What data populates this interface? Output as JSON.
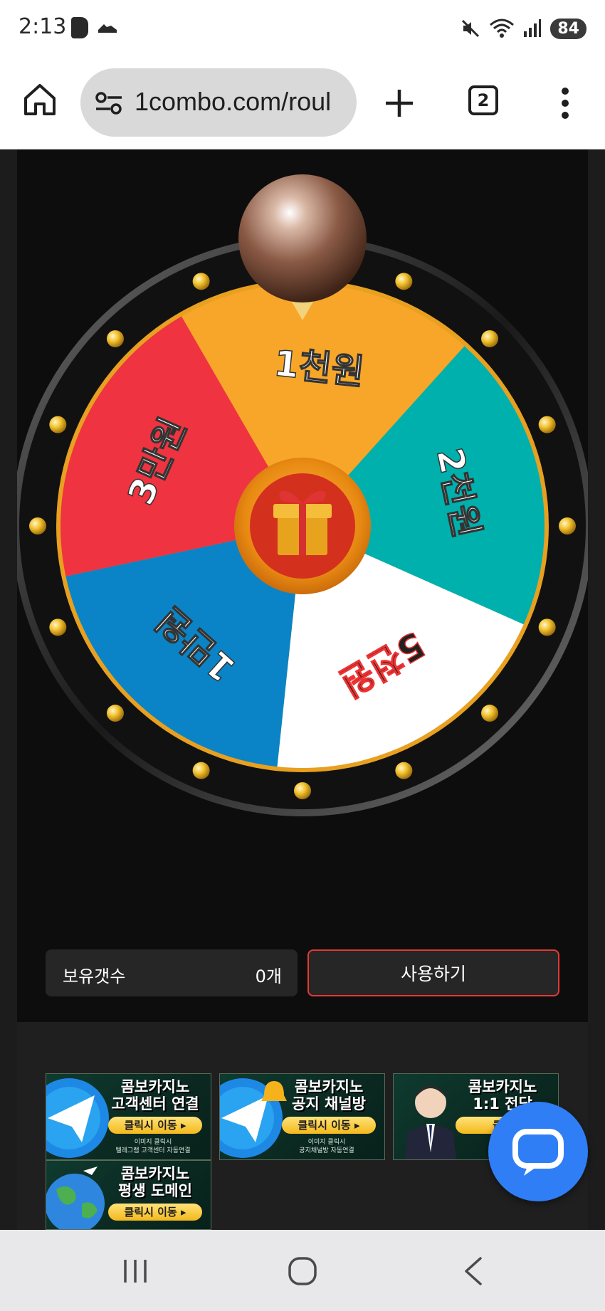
{
  "status_bar": {
    "time": "2:13",
    "battery": "84",
    "icons": [
      "b-app-icon",
      "shoe-app-icon",
      "mute-icon",
      "wifi-icon",
      "signal-icon",
      "battery-icon"
    ]
  },
  "browser": {
    "url": "1combo.com/roul",
    "tab_count": "2",
    "icons": [
      "home-icon",
      "site-settings-icon",
      "new-tab-plus-icon",
      "tabs-icon",
      "more-menu-icon"
    ]
  },
  "wheel": {
    "segments": [
      {
        "label": "1천원",
        "color": "#f7a629",
        "text_color": "#ffffff"
      },
      {
        "label": "2천원",
        "color": "#00b0ad",
        "text_color": "#ffffff"
      },
      {
        "label": "5천원",
        "color": "#ffffff",
        "text_color": "#222222"
      },
      {
        "label": "1만원",
        "color": "#0a84c6",
        "text_color": "#ffffff"
      },
      {
        "label": "3만원",
        "color": "#ef3340",
        "text_color": "#ffffff"
      }
    ],
    "center_icon": "gift-box-icon",
    "pointer_icon": "bronze-ball-pointer-icon",
    "rim_color": "#1a1a1a",
    "bulb_color": "#f0b429"
  },
  "controls": {
    "count_label": "보유갯수",
    "count_value": "0개",
    "use_button": "사용하기"
  },
  "banners": [
    {
      "title_line1": "콤보카지노",
      "title_line2": "고객센터 연결",
      "cta": "클릭시 이동 ▸",
      "sub_line1": "이미지 클릭시",
      "sub_line2": "텔레그램 고객센터 자동연결",
      "icon": "telegram-icon"
    },
    {
      "title_line1": "콤보카지노",
      "title_line2": "공지 채널방",
      "cta": "클릭시 이동 ▸",
      "sub_line1": "이미지 클릭시",
      "sub_line2": "공지채널방 자동연결",
      "icon": "telegram-bell-icon"
    },
    {
      "title_line1": "콤보카지노",
      "title_line2": "1:1 전담",
      "cta": "클릭",
      "sub_line1": "전담",
      "sub_line2": "",
      "icon": "agent-avatar-icon"
    },
    {
      "title_line1": "콤보카지노",
      "title_line2": "평생 도메인",
      "cta": "클릭시 이동 ▸",
      "sub_line1": "",
      "sub_line2": "",
      "icon": "globe-icon"
    }
  ],
  "chat_button": {
    "icon": "chat-bubble-icon",
    "color": "#2f7ef6"
  },
  "nav_bar": {
    "icons": [
      "recent-apps-icon",
      "home-circle-icon",
      "back-icon"
    ]
  }
}
